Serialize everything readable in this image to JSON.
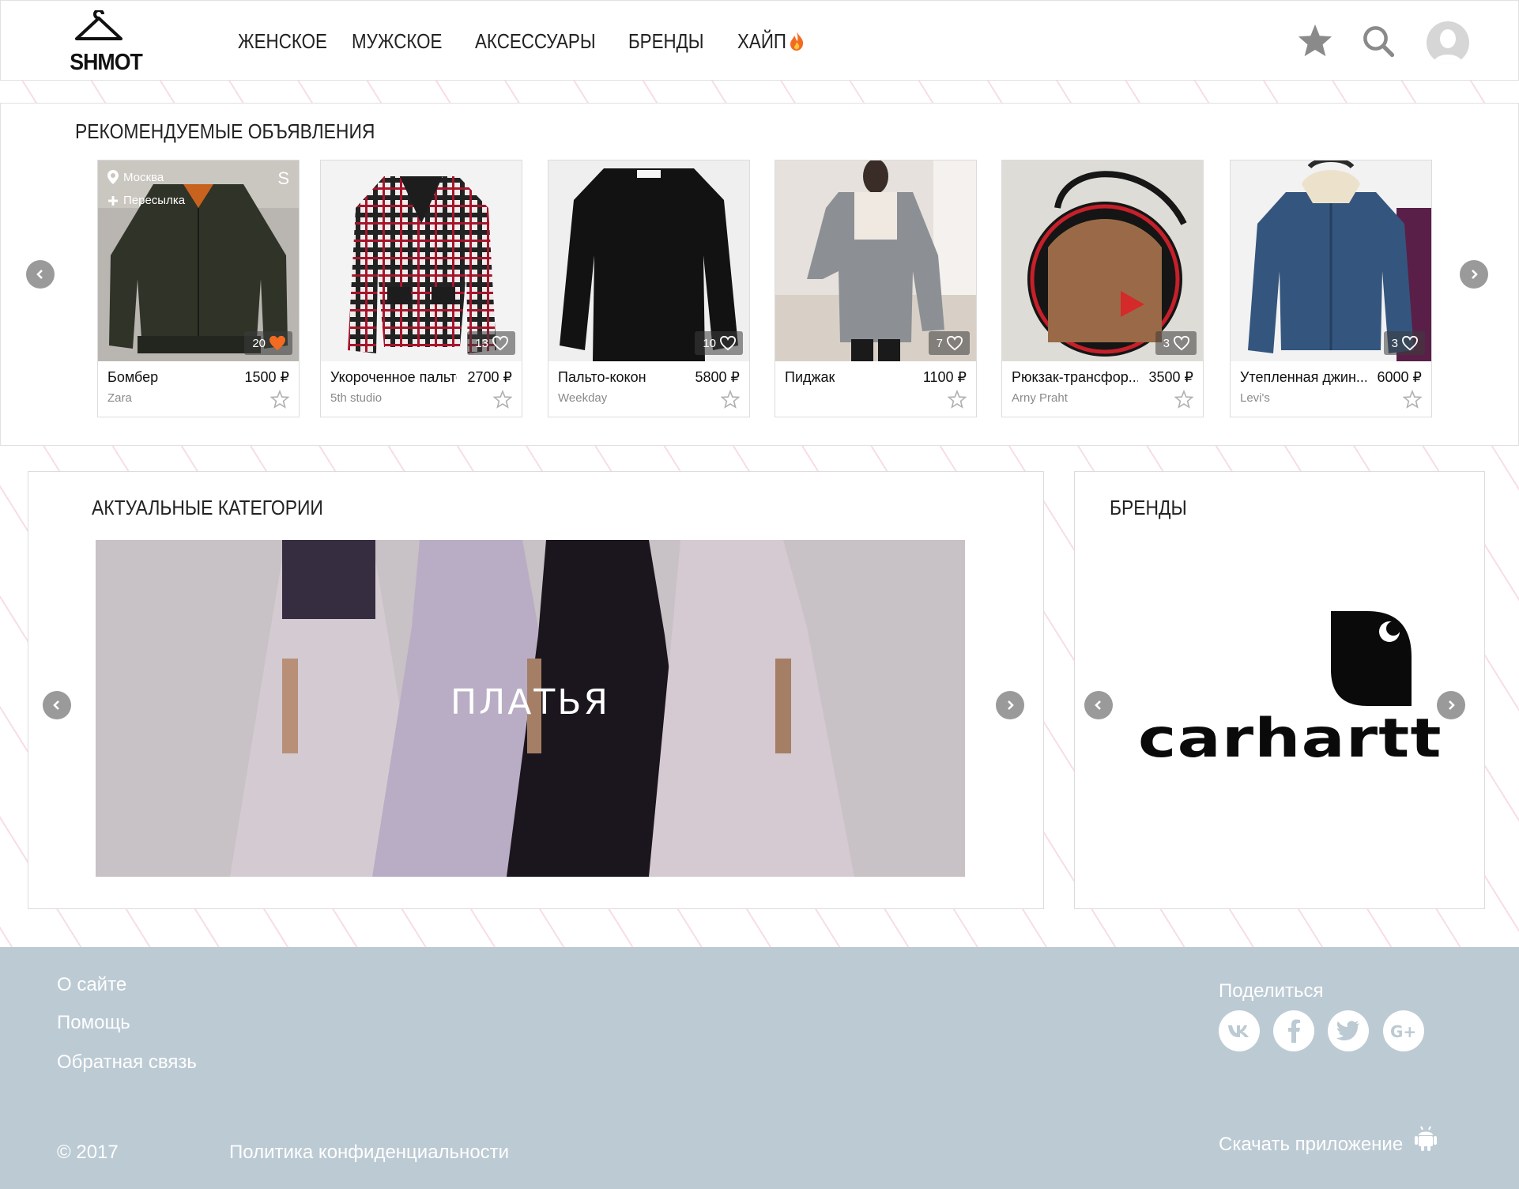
{
  "header": {
    "logo_text": "SHMOT",
    "nav": [
      "ЖЕНСКОЕ",
      "МУЖСКОЕ",
      "АКСЕССУАРЫ",
      "БРЕНДЫ",
      "ХАЙП"
    ],
    "icons": [
      "star-icon",
      "search-icon",
      "avatar-icon"
    ]
  },
  "recommended": {
    "title": "РЕКОМЕНДУЕМЫЕ ОБЪЯВЛЕНИЯ",
    "items": [
      {
        "title": "Бомбер",
        "price": "1500 ₽",
        "brand": "Zara",
        "likes": "20",
        "liked": true,
        "location": "Москва",
        "shipping": "Пересылка",
        "size": "S"
      },
      {
        "title": "Укороченное пальто",
        "price": "2700 ₽",
        "brand": "5th studio",
        "likes": "13",
        "liked": false
      },
      {
        "title": "Пальто-кокон",
        "price": "5800 ₽",
        "brand": "Weekday",
        "likes": "10",
        "liked": false
      },
      {
        "title": "Пиджак",
        "price": "1100 ₽",
        "brand": "",
        "likes": "7",
        "liked": false
      },
      {
        "title": "Рюкзак-трансфор...",
        "price": "3500 ₽",
        "brand": "Arny Praht",
        "likes": "3",
        "liked": false
      },
      {
        "title": "Утепленная джин...",
        "price": "6000 ₽",
        "brand": "Levi's",
        "likes": "3",
        "liked": false
      }
    ]
  },
  "categories": {
    "title": "АКТУАЛЬНЫЕ КАТЕГОРИИ",
    "current": "ПЛАТЬЯ"
  },
  "brands": {
    "title": "БРЕНДЫ",
    "current": "carhartt"
  },
  "footer": {
    "links": [
      "О сайте",
      "Помощь",
      "Обратная связь"
    ],
    "copyright": "© 2017",
    "privacy": "Политика конфиденциальности",
    "share_label": "Поделиться",
    "social": [
      "vk-icon",
      "facebook-icon",
      "twitter-icon",
      "google-plus-icon"
    ],
    "app_label": "Скачать приложение"
  },
  "colors": {
    "accent_heart": "#f26b21",
    "footer_bg": "#bccad3",
    "arrow": "#9a9a9a"
  }
}
